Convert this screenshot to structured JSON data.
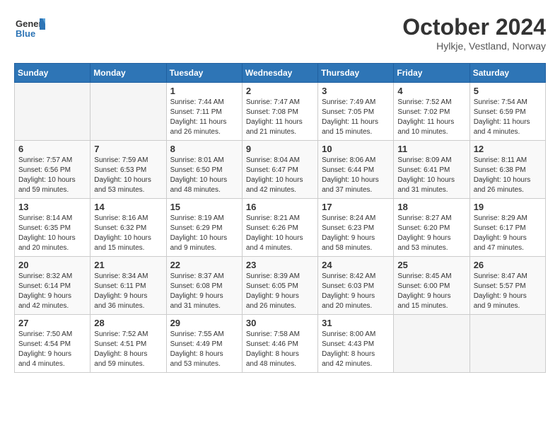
{
  "header": {
    "logo_general": "General",
    "logo_blue": "Blue",
    "month_title": "October 2024",
    "location": "Hylkje, Vestland, Norway"
  },
  "days_of_week": [
    "Sunday",
    "Monday",
    "Tuesday",
    "Wednesday",
    "Thursday",
    "Friday",
    "Saturday"
  ],
  "weeks": [
    [
      {
        "day": "",
        "info": ""
      },
      {
        "day": "",
        "info": ""
      },
      {
        "day": "1",
        "info": "Sunrise: 7:44 AM\nSunset: 7:11 PM\nDaylight: 11 hours\nand 26 minutes."
      },
      {
        "day": "2",
        "info": "Sunrise: 7:47 AM\nSunset: 7:08 PM\nDaylight: 11 hours\nand 21 minutes."
      },
      {
        "day": "3",
        "info": "Sunrise: 7:49 AM\nSunset: 7:05 PM\nDaylight: 11 hours\nand 15 minutes."
      },
      {
        "day": "4",
        "info": "Sunrise: 7:52 AM\nSunset: 7:02 PM\nDaylight: 11 hours\nand 10 minutes."
      },
      {
        "day": "5",
        "info": "Sunrise: 7:54 AM\nSunset: 6:59 PM\nDaylight: 11 hours\nand 4 minutes."
      }
    ],
    [
      {
        "day": "6",
        "info": "Sunrise: 7:57 AM\nSunset: 6:56 PM\nDaylight: 10 hours\nand 59 minutes."
      },
      {
        "day": "7",
        "info": "Sunrise: 7:59 AM\nSunset: 6:53 PM\nDaylight: 10 hours\nand 53 minutes."
      },
      {
        "day": "8",
        "info": "Sunrise: 8:01 AM\nSunset: 6:50 PM\nDaylight: 10 hours\nand 48 minutes."
      },
      {
        "day": "9",
        "info": "Sunrise: 8:04 AM\nSunset: 6:47 PM\nDaylight: 10 hours\nand 42 minutes."
      },
      {
        "day": "10",
        "info": "Sunrise: 8:06 AM\nSunset: 6:44 PM\nDaylight: 10 hours\nand 37 minutes."
      },
      {
        "day": "11",
        "info": "Sunrise: 8:09 AM\nSunset: 6:41 PM\nDaylight: 10 hours\nand 31 minutes."
      },
      {
        "day": "12",
        "info": "Sunrise: 8:11 AM\nSunset: 6:38 PM\nDaylight: 10 hours\nand 26 minutes."
      }
    ],
    [
      {
        "day": "13",
        "info": "Sunrise: 8:14 AM\nSunset: 6:35 PM\nDaylight: 10 hours\nand 20 minutes."
      },
      {
        "day": "14",
        "info": "Sunrise: 8:16 AM\nSunset: 6:32 PM\nDaylight: 10 hours\nand 15 minutes."
      },
      {
        "day": "15",
        "info": "Sunrise: 8:19 AM\nSunset: 6:29 PM\nDaylight: 10 hours\nand 9 minutes."
      },
      {
        "day": "16",
        "info": "Sunrise: 8:21 AM\nSunset: 6:26 PM\nDaylight: 10 hours\nand 4 minutes."
      },
      {
        "day": "17",
        "info": "Sunrise: 8:24 AM\nSunset: 6:23 PM\nDaylight: 9 hours\nand 58 minutes."
      },
      {
        "day": "18",
        "info": "Sunrise: 8:27 AM\nSunset: 6:20 PM\nDaylight: 9 hours\nand 53 minutes."
      },
      {
        "day": "19",
        "info": "Sunrise: 8:29 AM\nSunset: 6:17 PM\nDaylight: 9 hours\nand 47 minutes."
      }
    ],
    [
      {
        "day": "20",
        "info": "Sunrise: 8:32 AM\nSunset: 6:14 PM\nDaylight: 9 hours\nand 42 minutes."
      },
      {
        "day": "21",
        "info": "Sunrise: 8:34 AM\nSunset: 6:11 PM\nDaylight: 9 hours\nand 36 minutes."
      },
      {
        "day": "22",
        "info": "Sunrise: 8:37 AM\nSunset: 6:08 PM\nDaylight: 9 hours\nand 31 minutes."
      },
      {
        "day": "23",
        "info": "Sunrise: 8:39 AM\nSunset: 6:05 PM\nDaylight: 9 hours\nand 26 minutes."
      },
      {
        "day": "24",
        "info": "Sunrise: 8:42 AM\nSunset: 6:03 PM\nDaylight: 9 hours\nand 20 minutes."
      },
      {
        "day": "25",
        "info": "Sunrise: 8:45 AM\nSunset: 6:00 PM\nDaylight: 9 hours\nand 15 minutes."
      },
      {
        "day": "26",
        "info": "Sunrise: 8:47 AM\nSunset: 5:57 PM\nDaylight: 9 hours\nand 9 minutes."
      }
    ],
    [
      {
        "day": "27",
        "info": "Sunrise: 7:50 AM\nSunset: 4:54 PM\nDaylight: 9 hours\nand 4 minutes."
      },
      {
        "day": "28",
        "info": "Sunrise: 7:52 AM\nSunset: 4:51 PM\nDaylight: 8 hours\nand 59 minutes."
      },
      {
        "day": "29",
        "info": "Sunrise: 7:55 AM\nSunset: 4:49 PM\nDaylight: 8 hours\nand 53 minutes."
      },
      {
        "day": "30",
        "info": "Sunrise: 7:58 AM\nSunset: 4:46 PM\nDaylight: 8 hours\nand 48 minutes."
      },
      {
        "day": "31",
        "info": "Sunrise: 8:00 AM\nSunset: 4:43 PM\nDaylight: 8 hours\nand 42 minutes."
      },
      {
        "day": "",
        "info": ""
      },
      {
        "day": "",
        "info": ""
      }
    ]
  ]
}
